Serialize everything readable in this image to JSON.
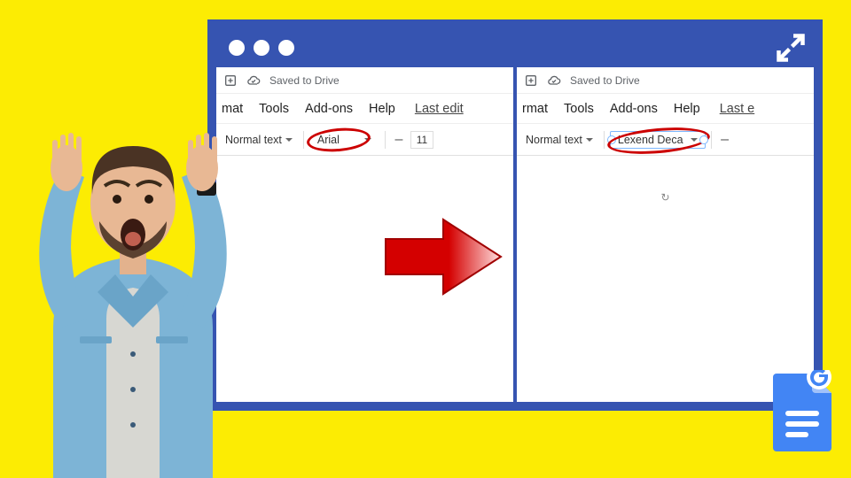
{
  "window": {
    "dots": 3
  },
  "left": {
    "drive_status": "Saved to Drive",
    "menu": {
      "fragment": "mat",
      "tools": "Tools",
      "addons": "Add-ons",
      "help": "Help",
      "last": "Last edit"
    },
    "toolbar": {
      "style_fragment": "Normal text",
      "font": "Arial",
      "size": "11",
      "minus": "–"
    }
  },
  "right": {
    "drive_status": "Saved to Drive",
    "menu": {
      "fragment": "rmat",
      "tools": "Tools",
      "addons": "Add-ons",
      "help": "Help",
      "last": "Last e"
    },
    "toolbar": {
      "style_fragment": "Normal text",
      "font": "Lexend Deca",
      "minus": "–"
    },
    "reload_glyph": "↻"
  },
  "icons": {
    "insert": "insert-icon",
    "cloud": "cloud-saved-icon",
    "expand": "expand-icon"
  }
}
